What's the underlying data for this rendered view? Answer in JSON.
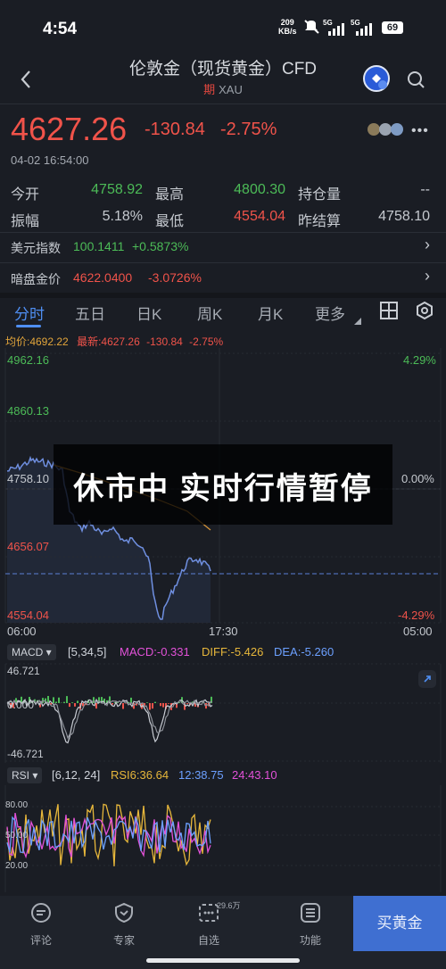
{
  "status": {
    "time": "4:54",
    "speed_value": "209",
    "speed_unit": "KB/s",
    "net1": "5G",
    "net2": "5G",
    "battery": "69"
  },
  "header": {
    "title": "伦敦金（现货黄金）CFD",
    "badge": "期",
    "symbol": "XAU"
  },
  "quote": {
    "price": "4627.26",
    "change": "-130.84",
    "change_pct": "-2.75%",
    "time": "04-02 16:54:00"
  },
  "stats": [
    {
      "label": "今开",
      "value": "4758.92",
      "color": "#4cbb57"
    },
    {
      "label": "最高",
      "value": "4800.30",
      "color": "#4cbb57"
    },
    {
      "label": "持仓量",
      "value": "--",
      "color": "#c5c9cf"
    },
    {
      "label": "振幅",
      "value": "5.18%",
      "color": "#c5c9cf"
    },
    {
      "label": "最低",
      "value": "4554.04",
      "color": "#f0534a"
    },
    {
      "label": "昨结算",
      "value": "4758.10",
      "color": "#c5c9cf"
    }
  ],
  "related": [
    {
      "label": "美元指数",
      "value": "100.1411",
      "change": "+0.5873%",
      "color": "#4cbb57"
    },
    {
      "label": "暗盘金价",
      "value": "4622.0400",
      "change": "-3.0726%",
      "color": "#f0534a"
    }
  ],
  "tabs": [
    "分时",
    "五日",
    "日K",
    "周K",
    "月K",
    "更多"
  ],
  "chart": {
    "avg_label": "均价:4692.22",
    "latest_label": "最新:4627.26",
    "latest_change": "-130.84",
    "latest_pct": "-2.75%",
    "y_labels": [
      "4962.16",
      "4860.13",
      "4758.10",
      "4656.07",
      "4554.04"
    ],
    "pct_labels": [
      "4.29%",
      "0.00%",
      "-4.29%"
    ],
    "x_labels": [
      "06:00",
      "17:30",
      "05:00"
    ],
    "overlay_text": "休市中 实时行情暂停"
  },
  "macd": {
    "name": "MACD",
    "params": "[5,34,5]",
    "macd": "MACD:-0.331",
    "diff": "DIFF:-5.426",
    "dea": "DEA:-5.260",
    "top": "46.721",
    "mid": "0.000",
    "bottom": "-46.721"
  },
  "rsi": {
    "name": "RSI",
    "params": "[6,12, 24]",
    "rsi6": "RSI6:36.64",
    "rsi12": "12:38.75",
    "rsi24": "24:43.10",
    "top": "80.00",
    "mid": "50.00",
    "bottom": "20.00"
  },
  "nav": {
    "comment": "评论",
    "expert": "专家",
    "watchlist": "自选",
    "watch_count": "29.6万",
    "function": "功能",
    "buy": "买黄金"
  },
  "colors": {
    "up": "#f0534a",
    "down": "#4cbb57",
    "accent": "#4f8ff3",
    "avg": "#e2a53b"
  }
}
